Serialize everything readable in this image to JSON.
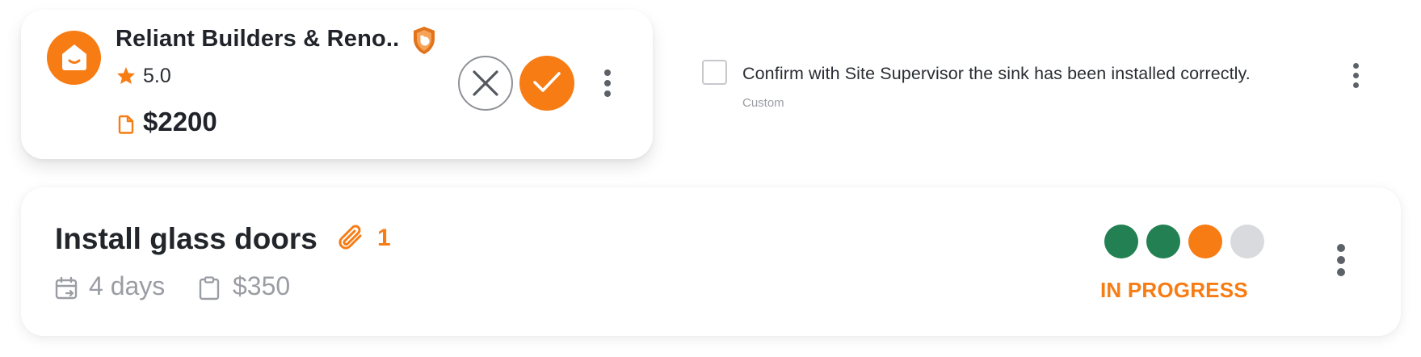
{
  "quote": {
    "builder_name": "Reliant Builders & Reno..",
    "rating": "5.0",
    "price": "$2200"
  },
  "checklist": {
    "text": "Confirm with Site Supervisor the sink has been installed correctly.",
    "tag": "Custom"
  },
  "task": {
    "title": "Install glass doors",
    "attachments": "1",
    "duration": "4 days",
    "cost": "$350",
    "status": "IN PROGRESS",
    "progress_steps": [
      "complete",
      "complete",
      "current",
      "pending"
    ]
  },
  "colors": {
    "accent": "#f77c14",
    "complete": "#228052",
    "pending": "#d8dadd"
  },
  "icons": [
    "home-icon",
    "shield-badge-icon",
    "star-icon",
    "document-icon",
    "close-icon",
    "check-icon",
    "more-vertical-icon",
    "paperclip-icon",
    "calendar-icon",
    "clipboard-icon"
  ]
}
